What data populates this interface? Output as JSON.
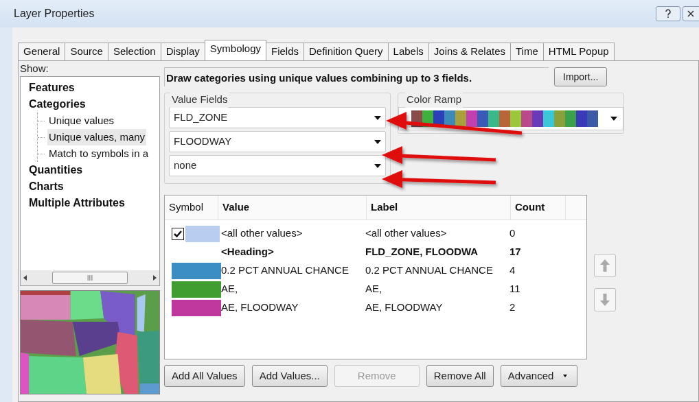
{
  "window": {
    "title": "Layer Properties"
  },
  "tabs": [
    {
      "label": "General",
      "selected": false
    },
    {
      "label": "Source",
      "selected": false
    },
    {
      "label": "Selection",
      "selected": false
    },
    {
      "label": "Display",
      "selected": false
    },
    {
      "label": "Symbology",
      "selected": true
    },
    {
      "label": "Fields",
      "selected": false
    },
    {
      "label": "Definition Query",
      "selected": false
    },
    {
      "label": "Labels",
      "selected": false
    },
    {
      "label": "Joins & Relates",
      "selected": false
    },
    {
      "label": "Time",
      "selected": false
    },
    {
      "label": "HTML Popup",
      "selected": false
    }
  ],
  "show": {
    "label": "Show:",
    "items": [
      {
        "label": "Features",
        "selected": false
      },
      {
        "label": "Categories",
        "selected": false,
        "children": [
          {
            "label": "Unique values",
            "selected": false
          },
          {
            "label": "Unique values, many",
            "selected": true
          },
          {
            "label": "Match to symbols in a",
            "selected": false
          }
        ]
      },
      {
        "label": "Quantities",
        "selected": false
      },
      {
        "label": "Charts",
        "selected": false
      },
      {
        "label": "Multiple Attributes",
        "selected": false
      }
    ],
    "scroll_grip": "III"
  },
  "description": "Draw categories using unique values combining up to 3 fields.",
  "import_button": "Import...",
  "value_fields": {
    "title": "Value Fields",
    "fields": [
      "FLD_ZONE",
      "FLOODWAY",
      "none"
    ]
  },
  "color_ramp": {
    "title": "Color Ramp"
  },
  "table": {
    "columns": [
      "Symbol",
      "Value",
      "Label",
      "Count"
    ],
    "rows": [
      {
        "kind": "other",
        "checked": true,
        "color": "#b8cdf0",
        "value": "<all other values>",
        "label": "<all other values>",
        "count": "0"
      },
      {
        "kind": "heading",
        "value": "<Heading>",
        "label": "FLD_ZONE, FLOODWA",
        "count": "17"
      },
      {
        "kind": "value",
        "color": "#3a8ec4",
        "value": "0.2 PCT ANNUAL CHANCE",
        "label": "0.2 PCT ANNUAL CHANCE",
        "count": "4"
      },
      {
        "kind": "value",
        "color": "#3f9e2f",
        "value": "AE,",
        "label": "AE,",
        "count": "11"
      },
      {
        "kind": "value",
        "color": "#c0389e",
        "value": "AE, FLOODWAY",
        "label": "AE, FLOODWAY",
        "count": "2"
      }
    ]
  },
  "buttons": [
    {
      "label": "Add All Values",
      "disabled": false,
      "kind": "plain"
    },
    {
      "label": "Add Values...",
      "disabled": false,
      "kind": "plain"
    },
    {
      "label": "Remove",
      "disabled": true,
      "kind": "plain"
    },
    {
      "label": "Remove All",
      "disabled": false,
      "kind": "plain"
    },
    {
      "label": "Advanced",
      "disabled": false,
      "kind": "menu"
    }
  ]
}
